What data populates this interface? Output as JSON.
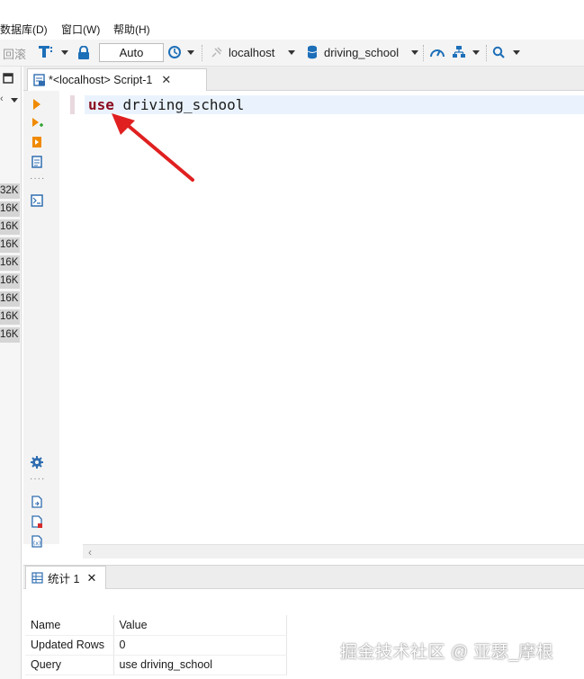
{
  "menu": {
    "items": [
      "数据库(D)",
      "窗口(W)",
      "帮助(H)"
    ]
  },
  "toolbar": {
    "rollback_label": "回滚",
    "transaction_mode": "Auto",
    "connection": "localhost",
    "database": "driving_school"
  },
  "left_panel": {
    "sizes": [
      "32K",
      "16K",
      "16K",
      "16K",
      "16K",
      "16K",
      "16K",
      "16K",
      "16K"
    ]
  },
  "editor": {
    "tab_title": "*<localhost> Script-1",
    "code": {
      "keyword": "use",
      "argument": "driving_school"
    }
  },
  "annotation": {
    "arrow_color": "#e02020"
  },
  "results": {
    "tab_title": "统计 1",
    "columns": [
      "Name",
      "Value"
    ],
    "rows": [
      [
        "Updated Rows",
        "0"
      ],
      [
        "Query",
        "use driving_school"
      ]
    ]
  },
  "watermark": "掘金技术社区 @ 亚瑟_摩根",
  "colors": {
    "keyword": "#8b0a1e",
    "accent_orange": "#f08a00",
    "accent_blue": "#1d6fb8"
  }
}
